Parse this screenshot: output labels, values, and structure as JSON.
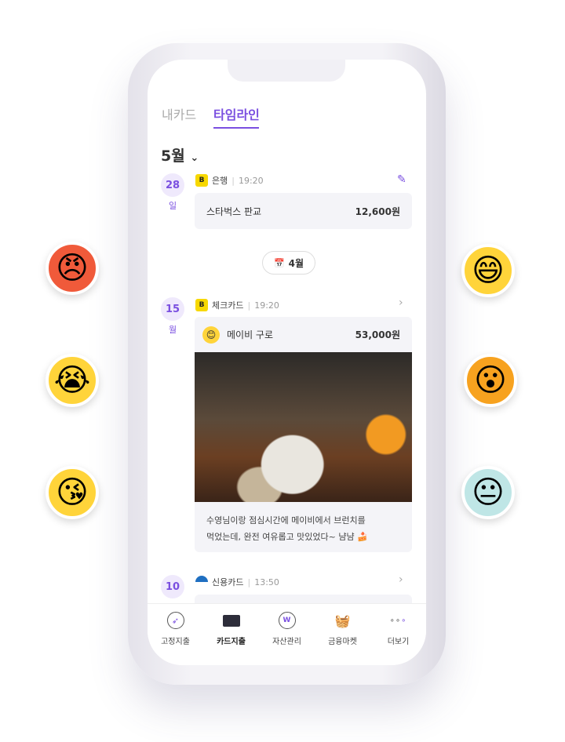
{
  "tabs": [
    {
      "label": "내카드"
    },
    {
      "label": "타임라인"
    }
  ],
  "month": "5월",
  "entries": [
    {
      "day": "28",
      "dow": "일",
      "source": "은행",
      "time": "19:20",
      "merchant": "스타벅스 판교",
      "amount": "12,600원"
    },
    {
      "day": "15",
      "dow": "월",
      "source": "체크카드",
      "time": "19:20",
      "merchant": "메이비 구로",
      "amount": "53,000원",
      "memo_line1": "수영님이랑 점심시간에 메이비에서 브런치를",
      "memo_line2": "먹었는데, 완전 여유롭고 맛있었다~ 냠냠 🍰"
    },
    {
      "day": "10",
      "source": "신용카드",
      "time": "13:50"
    }
  ],
  "month_divider": "4월",
  "bottom_nav": [
    {
      "label": "고정지출"
    },
    {
      "label": "카드지출"
    },
    {
      "label": "자산관리"
    },
    {
      "label": "금융마켓"
    },
    {
      "label": "더보기"
    }
  ],
  "colors": {
    "accent": "#7a4fe0"
  }
}
